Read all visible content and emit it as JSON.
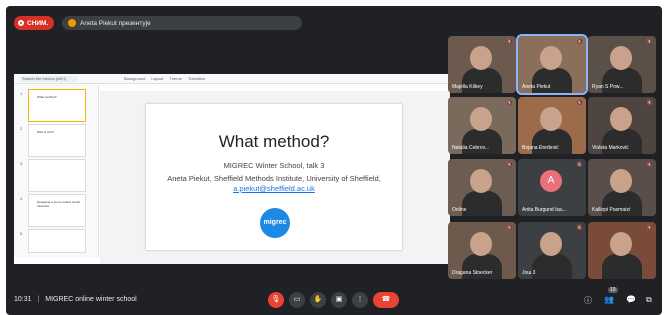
{
  "top": {
    "recording_label": "СНИМ.",
    "presenter_text": "Aneta Piekut презентује"
  },
  "slides_app": {
    "search_placeholder": "Search the menus (Alt+/)",
    "toolbar": [
      "Background",
      "Layout",
      "Theme",
      "Transition"
    ],
    "thumbnails": [
      {
        "num": "1",
        "title": "What method?"
      },
      {
        "num": "2",
        "title": "Who is who?"
      },
      {
        "num": "3",
        "title": ""
      },
      {
        "num": "4",
        "title": "Designing a tool to collect social networks"
      },
      {
        "num": "5",
        "title": ""
      }
    ]
  },
  "slide": {
    "title": "What method?",
    "subtitle": "MIGREC Winter School, talk 3",
    "author_line": "Aneta Piekut, Sheffield Methods Institute, University of Sheffield,",
    "email": "a.piekut@sheffield.ac.uk",
    "logo_text": "migrec"
  },
  "participants": [
    {
      "name": "Majella Kilkey",
      "initial": "",
      "active": false
    },
    {
      "name": "Aneta Piekut",
      "initial": "",
      "active": true
    },
    {
      "name": "Ryan S Pow...",
      "initial": "",
      "active": false
    },
    {
      "name": "Natalia Cebrov...",
      "initial": "",
      "active": false
    },
    {
      "name": "Bojana Đorđević",
      "initial": "",
      "active": false
    },
    {
      "name": "Violeta Marković",
      "initial": "",
      "active": false
    },
    {
      "name": "Online",
      "initial": "",
      "active": false
    },
    {
      "name": "Anita Burgund Isa...",
      "initial": "A",
      "active": false
    },
    {
      "name": "Kalliopi Pasmatzi",
      "initial": "",
      "active": false
    },
    {
      "name": "Dragana Stoecker",
      "initial": "",
      "active": false
    },
    {
      "name": "Још 3",
      "initial": "",
      "active": false
    },
    {
      "name": "",
      "initial": "",
      "active": false
    }
  ],
  "bottom": {
    "time": "10:31",
    "meeting": "MIGREC online winter school",
    "participant_count": "19"
  },
  "colors": {
    "accent_red": "#ea4335",
    "background": "#202124",
    "active_border": "#8ab4f8"
  }
}
